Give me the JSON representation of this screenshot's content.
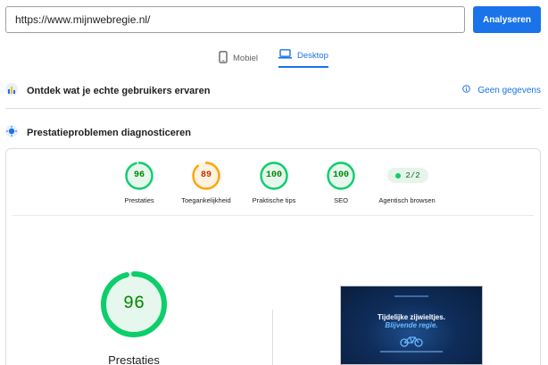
{
  "url_bar": {
    "value": "https://www.mijnwebregie.nl/"
  },
  "analyze_button": "Analyseren",
  "tabs": [
    {
      "label": "Mobiel",
      "icon": "phone-icon",
      "active": false
    },
    {
      "label": "Desktop",
      "icon": "laptop-icon",
      "active": true
    }
  ],
  "field_section": {
    "title": "Ontdek wat je echte gebruikers ervaren",
    "icon": "field-data-icon",
    "status": "Geen gegevens",
    "status_icon": "info-icon"
  },
  "lab_section": {
    "title": "Prestatieproblemen diagnosticeren",
    "icon": "lab-data-icon"
  },
  "categories": [
    {
      "label": "Prestaties",
      "score": 96,
      "color": "#0cce6b",
      "bg": "#e6f7ed",
      "text": "#008800"
    },
    {
      "label": "Toegankelijkheid",
      "score": 89,
      "color": "#ffa400",
      "bg": "#fff3e0",
      "text": "#c33300"
    },
    {
      "label": "Praktische tips",
      "score": 100,
      "color": "#0cce6b",
      "bg": "#e6f7ed",
      "text": "#008800"
    },
    {
      "label": "SEO",
      "score": 100,
      "color": "#0cce6b",
      "bg": "#e6f7ed",
      "text": "#008800"
    }
  ],
  "agentic": {
    "label": "Agentisch browsen",
    "value": "2/2"
  },
  "main_gauge": {
    "label": "Prestaties",
    "score": 96
  },
  "screenshot": {
    "line1": "Tijdelijke zijwieltjes.",
    "line2": "Blijvende regie."
  }
}
